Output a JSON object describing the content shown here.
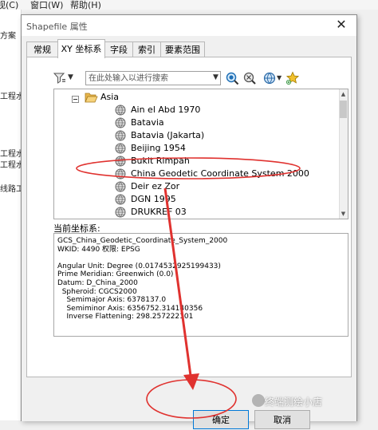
{
  "background": {
    "menu": [
      "视(C)",
      "窗口(W)",
      "帮助(H)"
    ],
    "left_labels": [
      "方案",
      "工程水",
      "工程水",
      "工程水",
      "线路工"
    ]
  },
  "dialog": {
    "title": "Shapefile 属性",
    "close": "✕",
    "tabs": [
      {
        "label": "常规",
        "active": false
      },
      {
        "label": "XY 坐标系",
        "active": true
      },
      {
        "label": "字段",
        "active": false
      },
      {
        "label": "索引",
        "active": false
      },
      {
        "label": "要素范围",
        "active": false
      }
    ],
    "toolbar": {
      "search_placeholder": "在此处输入以进行搜索",
      "icons": [
        "filter-icon",
        "search-icon",
        "clear-search-icon",
        "globe-icon",
        "star-icon"
      ]
    },
    "tree": {
      "folder": "Asia",
      "items": [
        "Ain el Abd 1970",
        "Batavia",
        "Batavia (Jakarta)",
        "Beijing 1954",
        "Bukit Rimpah",
        "China Geodetic Coordinate System 2000",
        "Deir ez Zor",
        "DGN 1995",
        "DRUKREF 03"
      ]
    },
    "current": {
      "label": "当前坐标系:",
      "lines": [
        "GCS_China_Geodetic_Coordinate_System_2000",
        "WKID: 4490 权限: EPSG",
        "",
        "Angular Unit: Degree (0.0174532925199433)",
        "Prime Meridian: Greenwich (0.0)",
        "Datum: D_China_2000",
        "  Spheroid: CGCS2000",
        "    Semimajor Axis: 6378137.0",
        "    Semiminor Axis: 6356752.314140356",
        "    Inverse Flattening: 298.257222101"
      ]
    },
    "buttons": {
      "ok": "确定",
      "cancel": "取消"
    }
  },
  "watermark": "终端测绘小店",
  "colors": {
    "annotation": "#e0322f",
    "selection_accent": "#0078d7"
  }
}
